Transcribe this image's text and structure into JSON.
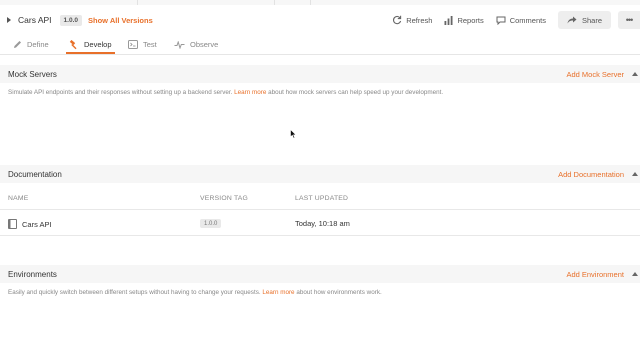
{
  "header": {
    "api_name": "Cars API",
    "version": "1.0.0",
    "show_all_versions": "Show All Versions",
    "actions": {
      "refresh": "Refresh",
      "reports": "Reports",
      "comments": "Comments",
      "share": "Share"
    }
  },
  "tabs": [
    {
      "label": "Define",
      "icon": "pencil-icon",
      "active": false
    },
    {
      "label": "Develop",
      "icon": "hammer-icon",
      "active": true
    },
    {
      "label": "Test",
      "icon": "test-icon",
      "active": false
    },
    {
      "label": "Observe",
      "icon": "pulse-icon",
      "active": false
    }
  ],
  "mock_servers": {
    "title": "Mock Servers",
    "add_label": "Add Mock Server",
    "desc_before": "Simulate API endpoints and their responses without setting up a backend server.",
    "desc_link": "Learn more",
    "desc_after": "about how mock servers can help speed up your development."
  },
  "documentation": {
    "title": "Documentation",
    "add_label": "Add Documentation",
    "columns": {
      "name": "NAME",
      "version_tag": "VERSION TAG",
      "last_updated": "LAST UPDATED"
    },
    "rows": [
      {
        "name": "Cars API",
        "version_tag": "1.0.0",
        "last_updated": "Today, 10:18 am"
      }
    ]
  },
  "environments": {
    "title": "Environments",
    "add_label": "Add Environment",
    "desc_before": "Easily and quickly switch between different setups without having to change your requests.",
    "desc_link": "Learn more",
    "desc_after": "about how environments work."
  },
  "colors": {
    "accent": "#e8702a",
    "section_bg": "#f6f6f6",
    "text": "#333333",
    "muted": "#888888"
  }
}
